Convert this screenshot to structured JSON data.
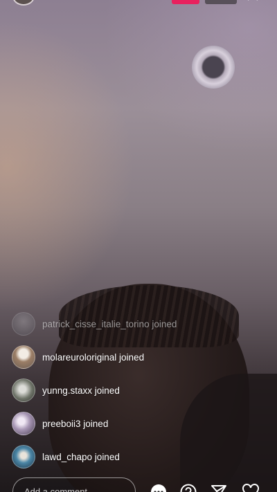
{
  "joined": {
    "suffix": "joined",
    "users": [
      {
        "username": "patrick_cisse_italie_torino",
        "text": "patrick_cisse_italie_torino joined",
        "avatar_color": "#6d6a6e",
        "faded": true
      },
      {
        "username": "molareuroloriginal",
        "text": "molareuroloriginal joined",
        "avatar_color": "#c9b7a6",
        "faded": false
      },
      {
        "username": "yunng.staxx",
        "text": "yunng.staxx joined",
        "avatar_color": "#7a7f74",
        "faded": false
      },
      {
        "username": "preeboii3",
        "text": "preeboii3 joined",
        "avatar_color": "#b7a8c2",
        "faded": false
      },
      {
        "username": "lawd_chapo",
        "text": "lawd_chapo joined",
        "avatar_color": "#3f6d8a",
        "faded": false
      }
    ]
  },
  "comment": {
    "placeholder": "Add a comment..."
  },
  "icons": {
    "more": "more-options-icon",
    "question": "question-icon",
    "share": "send-icon",
    "like": "heart-icon",
    "close": "close-icon"
  },
  "colors": {
    "live_badge": "#e8215e"
  }
}
